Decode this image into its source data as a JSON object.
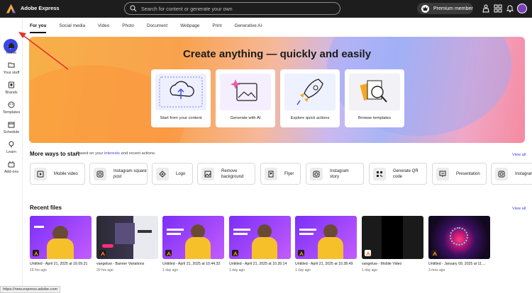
{
  "app": {
    "title": "Adobe Express"
  },
  "search": {
    "placeholder": "Search for content or generate your own"
  },
  "header": {
    "premium_label": "Premium member"
  },
  "sidebar": {
    "items": [
      {
        "label": "Home",
        "icon": "home-icon"
      },
      {
        "label": "Your stuff",
        "icon": "folder-icon"
      },
      {
        "label": "Brands",
        "icon": "brand-icon"
      },
      {
        "label": "Templates",
        "icon": "templates-icon"
      },
      {
        "label": "Schedule",
        "icon": "calendar-icon"
      },
      {
        "label": "Learn",
        "icon": "lightbulb-icon"
      },
      {
        "label": "Add-ons",
        "icon": "addons-icon"
      }
    ]
  },
  "tabs": [
    "For you",
    "Social media",
    "Video",
    "Photo",
    "Document",
    "Webpage",
    "Print",
    "Generative AI"
  ],
  "hero": {
    "title": "Create anything — quickly and easily",
    "cards": [
      {
        "label": "Start from your content"
      },
      {
        "label": "Generate with AI"
      },
      {
        "label": "Explore quick actions"
      },
      {
        "label": "Browse templates"
      }
    ]
  },
  "more": {
    "title": "More ways to start",
    "sub_prefix": "Based on your ",
    "sub_link": "interests",
    "sub_suffix": " and recent actions.",
    "view_all": "View all",
    "items": [
      {
        "label": "Mobile video",
        "icon": "video-icon"
      },
      {
        "label": "Instagram square post",
        "icon": "instagram-icon"
      },
      {
        "label": "Logo",
        "icon": "logo-icon"
      },
      {
        "label": "Remove background",
        "icon": "image-icon"
      },
      {
        "label": "Flyer",
        "icon": "flyer-icon"
      },
      {
        "label": "Instagram story",
        "icon": "instagram-icon"
      },
      {
        "label": "Generate QR code",
        "icon": "qr-code-icon"
      },
      {
        "label": "Presentation",
        "icon": "presentation-icon"
      },
      {
        "label": "Instagram",
        "icon": "instagram-icon"
      }
    ]
  },
  "recent": {
    "title": "Recent files",
    "view_all": "View all",
    "files": [
      {
        "name": "Untitled - April 21, 2025 at 16.09.31",
        "age": "19 hrs ago"
      },
      {
        "name": "vangeluw - Banner Variations",
        "age": "20 hrs ago"
      },
      {
        "name": "Untitled - April 21, 2025 at 10.44.32",
        "age": "1 day ago"
      },
      {
        "name": "Untitled - April 21, 2025 at 10.39.14",
        "age": "1 day ago"
      },
      {
        "name": "Untitled - April 21, 2025 at 10.38.49",
        "age": "1 day ago"
      },
      {
        "name": "vangeluw - Mobile Video",
        "age": "1 day ago"
      },
      {
        "name": "Untitled - January 09, 2025 at 11....",
        "age": "3 mos ago"
      }
    ]
  },
  "status": {
    "url": "https://new.express.adobe.com"
  },
  "colors": {
    "accent": "#3b45e6",
    "topbar": "#1d1d1d",
    "annotation": "#e5322d"
  }
}
